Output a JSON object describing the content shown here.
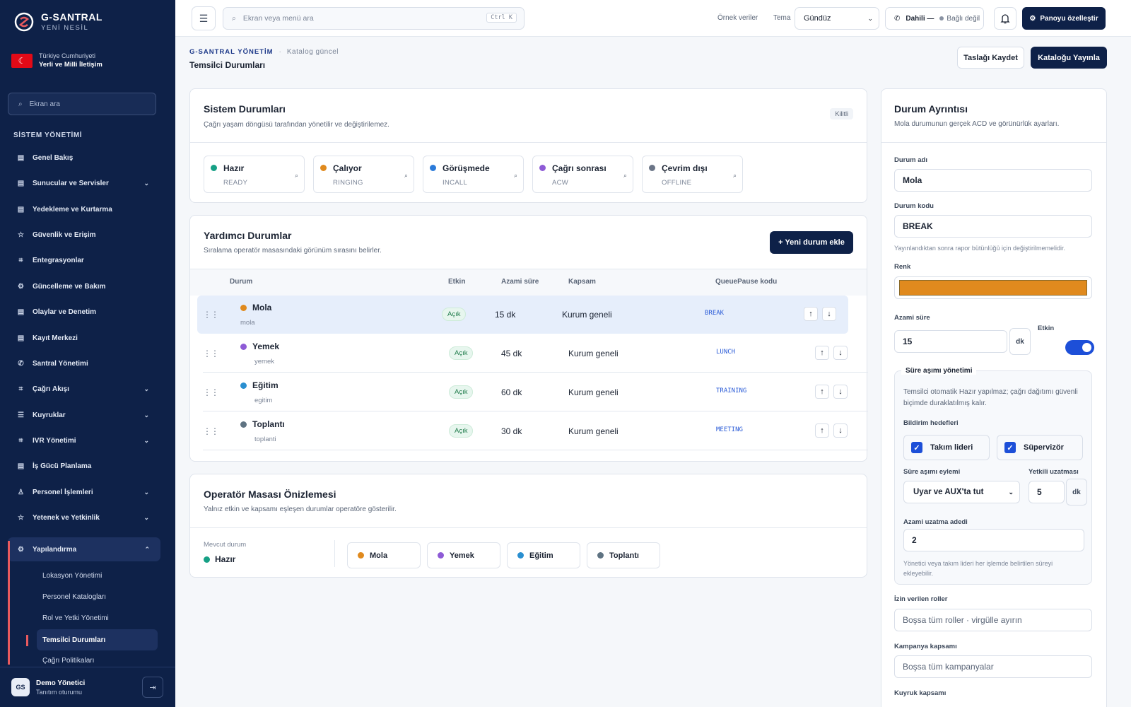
{
  "brand": {
    "title": "G-SANTRAL",
    "subtitle": "YENİ NESİL"
  },
  "country": {
    "line1": "Türkiye Cumhuriyeti",
    "line2": "Yerli ve Milli İletişim"
  },
  "sidebar": {
    "search_placeholder": "Ekran ara",
    "section": "SİSTEM YÖNETİMİ",
    "items": [
      {
        "label": "Genel Bakış",
        "icon": "dashboard-icon"
      },
      {
        "label": "Sunucular ve Servisler",
        "icon": "server-icon"
      },
      {
        "label": "Yedekleme ve Kurtarma",
        "icon": "backup-icon"
      },
      {
        "label": "Güvenlik ve Erişim",
        "icon": "star-icon"
      },
      {
        "label": "Entegrasyonlar",
        "icon": "integration-icon"
      },
      {
        "label": "Güncelleme ve Bakım",
        "icon": "gear-icon"
      },
      {
        "label": "Olaylar ve Denetim",
        "icon": "audit-icon"
      },
      {
        "label": "Kayıt Merkezi",
        "icon": "record-icon"
      },
      {
        "label": "Santral Yönetimi",
        "icon": "phone-icon"
      },
      {
        "label": "Çağrı Akışı",
        "icon": "flow-icon"
      },
      {
        "label": "Kuyruklar",
        "icon": "queue-icon"
      },
      {
        "label": "IVR Yönetimi",
        "icon": "ivr-icon"
      },
      {
        "label": "İş Gücü Planlama",
        "icon": "workforce-icon"
      },
      {
        "label": "Personel İşlemleri",
        "icon": "person-icon"
      },
      {
        "label": "Yetenek ve Yetkinlik",
        "icon": "star-icon"
      },
      {
        "label": "Yapılandırma",
        "icon": "gear-icon"
      }
    ],
    "subitems": [
      "Lokasyon Yönetimi",
      "Personel Katalogları",
      "Rol ve Yetki Yönetimi",
      "Temsilci Durumları",
      "Çağrı Politikaları"
    ]
  },
  "user": {
    "initials": "GS",
    "name": "Demo Yönetici",
    "session": "Tanıtım oturumu"
  },
  "topbar": {
    "search_placeholder": "Ekran veya menü ara",
    "shortcut": "Ctrl K",
    "sample_data": "Örnek veriler",
    "theme_label": "Tema",
    "theme_value": "Gündüz",
    "extension": "Dahili —",
    "connection": "Bağlı değil",
    "customize": "Panoyu özelleştir"
  },
  "breadcrumb": {
    "root": "G-SANTRAL YÖNETİM",
    "status": "Katalog güncel"
  },
  "page": {
    "title": "Temsilci Durumları",
    "save_draft": "Taslağı Kaydet",
    "publish": "Kataloğu Yayınla"
  },
  "system_states": {
    "title": "Sistem Durumları",
    "subtitle": "Çağrı yaşam döngüsü tarafından yönetilir ve değiştirilemez.",
    "lock": "Kilitli",
    "items": [
      {
        "name": "Hazır",
        "code": "READY",
        "color": "#16a085"
      },
      {
        "name": "Çalıyor",
        "code": "RINGING",
        "color": "#e08a1e"
      },
      {
        "name": "Görüşmede",
        "code": "INCALL",
        "color": "#2a7ad9"
      },
      {
        "name": "Çağrı sonrası",
        "code": "ACW",
        "color": "#8e5bd6"
      },
      {
        "name": "Çevrim dışı",
        "code": "OFFLINE",
        "color": "#6b7587"
      }
    ]
  },
  "aux_states": {
    "title": "Yardımcı Durumlar",
    "subtitle": "Sıralama operatör masasındaki görünüm sırasını belirler.",
    "add_button": "+ Yeni durum ekle",
    "columns": [
      "Durum",
      "Etkin",
      "Azami süre",
      "Kapsam",
      "QueuePause kodu"
    ],
    "rows": [
      {
        "name": "Mola",
        "slug": "mola",
        "enabled": "Açık",
        "duration": "15 dk",
        "scope": "Kurum geneli",
        "code": "BREAK",
        "color": "#e08a1e"
      },
      {
        "name": "Yemek",
        "slug": "yemek",
        "enabled": "Açık",
        "duration": "45 dk",
        "scope": "Kurum geneli",
        "code": "LUNCH",
        "color": "#8e5bd6"
      },
      {
        "name": "Eğitim",
        "slug": "egitim",
        "enabled": "Açık",
        "duration": "60 dk",
        "scope": "Kurum geneli",
        "code": "TRAINING",
        "color": "#2a8fd0"
      },
      {
        "name": "Toplantı",
        "slug": "toplanti",
        "enabled": "Açık",
        "duration": "30 dk",
        "scope": "Kurum geneli",
        "code": "MEETING",
        "color": "#5f7382"
      }
    ]
  },
  "preview": {
    "title": "Operatör Masası Önizlemesi",
    "subtitle": "Yalnız etkin ve kapsamı eşleşen durumlar operatöre gösterilir.",
    "current_label": "Mevcut durum",
    "current_value": "Hazır",
    "chips": [
      "Mola",
      "Yemek",
      "Eğitim",
      "Toplantı"
    ]
  },
  "detail": {
    "title": "Durum Ayrıntısı",
    "subtitle": "Mola durumunun gerçek ACD ve görünürlük ayarları.",
    "name_label": "Durum adı",
    "name_value": "Mola",
    "code_label": "Durum kodu",
    "code_value": "BREAK",
    "code_help": "Yayınlandıktan sonra rapor bütünlüğü için değiştirilmemelidir.",
    "color_label": "Renk",
    "color_value": "#e08a1e",
    "max_label": "Azami süre",
    "max_value": "15",
    "unit": "dk",
    "enabled_label": "Etkin",
    "overtime": {
      "title": "Süre aşımı yönetimi",
      "desc": "Temsilci otomatik Hazır yapılmaz; çağrı dağıtımı güvenli biçimde duraklatılmış kalır.",
      "targets_label": "Bildirim hedefleri",
      "target1": "Takım lideri",
      "target2": "Süpervizör",
      "action_label": "Süre aşımı eylemi",
      "action_value": "Uyar ve AUX'ta tut",
      "ext_label": "Yetkili uzatması",
      "ext_value": "5",
      "ext_unit": "dk",
      "maxext_label": "Azami uzatma adedi",
      "maxext_value": "2",
      "maxext_help": "Yönetici veya takım lideri her işlemde belirtilen süreyi ekleyebilir."
    },
    "roles_label": "İzin verilen roller",
    "roles_placeholder": "Boşsa tüm roller · virgülle ayırın",
    "campaign_label": "Kampanya kapsamı",
    "campaign_placeholder": "Boşsa tüm kampanyalar",
    "queue_label": "Kuyruk kapsamı"
  }
}
